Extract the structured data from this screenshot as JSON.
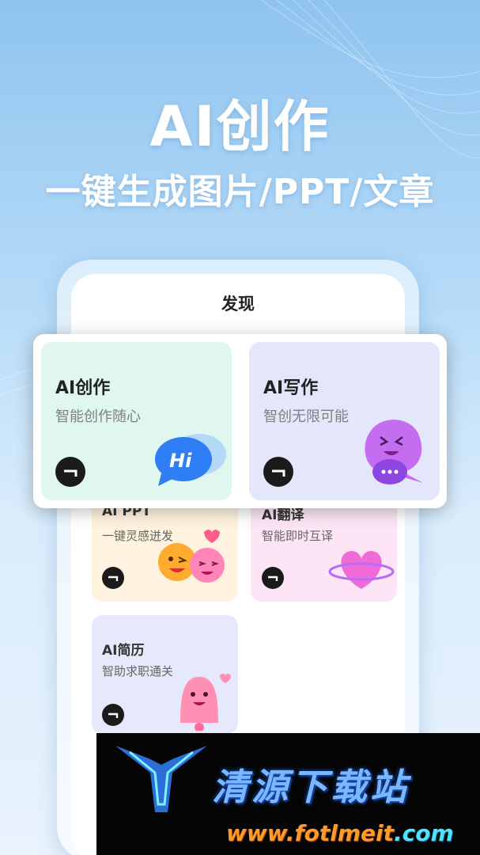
{
  "hero": {
    "title": "AI创作",
    "subtitle": "一键生成图片/PPT/文章"
  },
  "screen": {
    "title": "发现"
  },
  "featured_cards": [
    {
      "title": "AI创作",
      "subtitle": "智能创作随心",
      "bg": "#dff7ee",
      "icon": "hi-speech-bubble-icon"
    },
    {
      "title": "AI写作",
      "subtitle": "智创无限可能",
      "bg": "#e4e7fb",
      "icon": "purple-chat-mascot-icon"
    }
  ],
  "cards": [
    {
      "title": "AI PPT",
      "subtitle": "一键灵感迸发",
      "bg": "#fff3df",
      "icon": "emoji-faces-icon"
    },
    {
      "title": "AI翻译",
      "subtitle": "智能即时互译",
      "bg": "#fde5f5",
      "icon": "heart-planet-icon"
    },
    {
      "title": "AI简历",
      "subtitle": "智助求职通关",
      "bg": "#e6e9fb",
      "icon": "bell-mascot-icon"
    }
  ],
  "watermark": {
    "name": "清源下载站",
    "url_main": "www.fotlmeit",
    "url_suffix": ".com"
  },
  "colors": {
    "arrow_button": "#1b1b1b",
    "featured_green": "#dff7ee",
    "featured_purple": "#e4e7fb"
  }
}
